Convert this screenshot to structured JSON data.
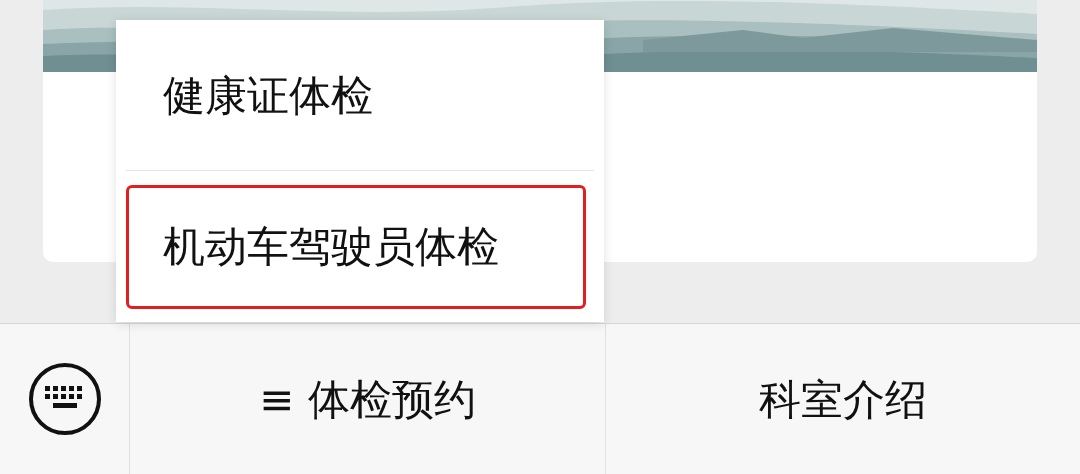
{
  "popup_menu": {
    "items": [
      {
        "label": "健康证体检",
        "highlighted": false
      },
      {
        "label": "机动车驾驶员体检",
        "highlighted": true
      }
    ]
  },
  "bottom_bar": {
    "menus": [
      {
        "label": "≡ 体检预约"
      },
      {
        "label": "科室介绍"
      }
    ]
  }
}
